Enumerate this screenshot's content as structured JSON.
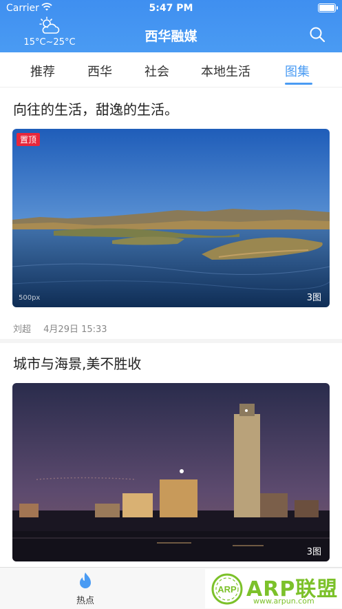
{
  "status_bar": {
    "carrier": "Carrier",
    "time": "5:47 PM"
  },
  "header": {
    "weather_icon": "partly-cloudy-icon",
    "temperature": "15°C~25°C",
    "title": "西华融媒",
    "search_icon": "search-icon"
  },
  "tabs": [
    {
      "label": "推荐",
      "active": false
    },
    {
      "label": "西华",
      "active": false
    },
    {
      "label": "社会",
      "active": false
    },
    {
      "label": "本地生活",
      "active": false
    },
    {
      "label": "图集",
      "active": true
    }
  ],
  "articles": [
    {
      "title": "向往的生活，甜逸的生活。",
      "pinned_badge": "置顶",
      "photo_watermark": "500px",
      "photo_count": "3图",
      "author": "刘超",
      "date": "4月29日 15:33"
    },
    {
      "title": "城市与海景,美不胜收",
      "photo_count": "3图"
    }
  ],
  "tab_bar": {
    "items": [
      {
        "label": "热点",
        "icon": "flame-icon"
      }
    ]
  },
  "watermark": {
    "name": "ARP联盟",
    "url": "www.arpun.com",
    "ring_text": "ARP"
  },
  "colors": {
    "accent": "#4a9bf3",
    "badge": "#e8273b",
    "watermark": "#7cc12a"
  }
}
